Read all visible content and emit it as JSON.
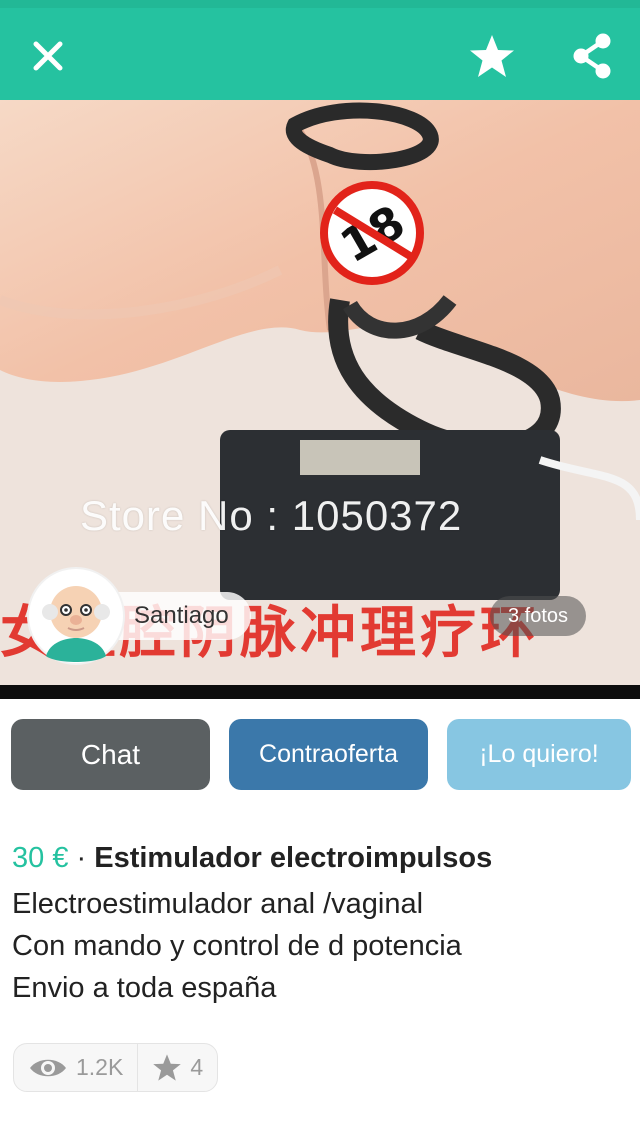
{
  "header": {
    "close_icon": "close-icon",
    "favorite_icon": "star-icon",
    "share_icon": "share-icon",
    "background_color": "#25c2a0"
  },
  "photo": {
    "overlay_text": "Store No : 1050372",
    "caption_text": "女盆腔阴脉冲理疗环",
    "badge_number": "18",
    "seller_name": "Santiago",
    "photo_count_label": "3 fotos"
  },
  "actions": {
    "chat_label": "Chat",
    "counter_offer_label": "Contraoferta",
    "want_label": "¡Lo quiero!"
  },
  "listing": {
    "price": "30 €",
    "separator": " · ",
    "title": "Estimulador electroimpulsos",
    "description": [
      "Electroestimulador anal /vaginal",
      "Con mando y control de d potencia",
      "Envio a toda españa"
    ]
  },
  "stats": {
    "views": "1.2K",
    "favorites": "4",
    "views_icon": "eye-icon",
    "favorites_icon": "star-icon"
  },
  "colors": {
    "accent": "#25c2a0",
    "chat": "#5b6062",
    "counter_offer": "#3b78aa",
    "want": "#87c6e2"
  }
}
